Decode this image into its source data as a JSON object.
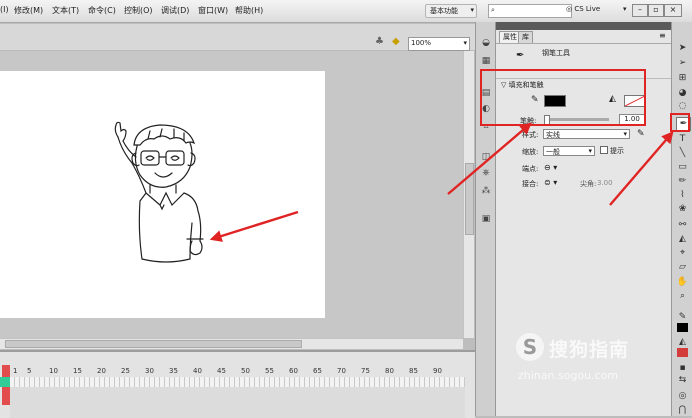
{
  "menu": {
    "items": [
      "(I)",
      "修改(M)",
      "文本(T)",
      "命令(C)",
      "控制(O)",
      "调试(D)",
      "窗口(W)",
      "帮助(H)"
    ],
    "workspace": "基本功能",
    "live": "CS Live"
  },
  "stage_toolbar": {
    "zoom": "100%"
  },
  "timeline": {
    "frames": [
      "1",
      "5",
      "10",
      "15",
      "20",
      "25",
      "30",
      "35",
      "40",
      "45",
      "50",
      "55",
      "60",
      "65",
      "70",
      "75",
      "80",
      "85",
      "90"
    ]
  },
  "panel": {
    "tabs": [
      "属性",
      "库"
    ],
    "tool_name": "钢笔工具",
    "section_title": "填充和笔触",
    "stroke_label": "笔触:",
    "stroke_value": "1.00",
    "style_label": "样式:",
    "style_value": "实线",
    "scale_label": "缩放:",
    "scale_value": "一般",
    "hint_label": "提示",
    "cap_label": "端点:",
    "join_label": "接合:",
    "miter_label": "尖角:",
    "miter_value": "3.00"
  },
  "watermark": {
    "brand": "搜狗指南",
    "url": "zhinan.sogou.com"
  },
  "colors": {
    "accent_red": "#e02424",
    "stroke_color": "#000000"
  }
}
